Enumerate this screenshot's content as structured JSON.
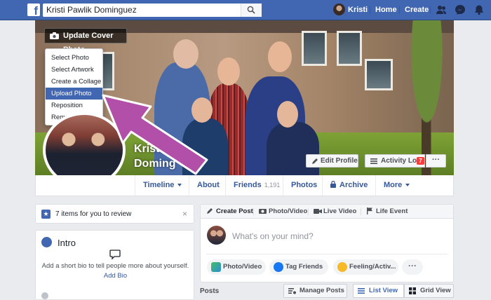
{
  "topbar": {
    "logo": "f",
    "search_value": "Kristi Pawlik Dominguez",
    "user_name": "Kristi",
    "links": [
      "Home",
      "Create"
    ]
  },
  "cover": {
    "update_label": "Update Cover Photo",
    "menu": [
      "Select Photo",
      "Select Artwork",
      "Create a Collage",
      "Upload Photo",
      "Reposition",
      "Remove"
    ],
    "active_menu_item": "Upload Photo",
    "name_line1": "Kristi",
    "name_line2": "Doming",
    "edit_profile": "Edit Profile",
    "activity_log": "Activity Log",
    "activity_badge": "7",
    "more": "···"
  },
  "tabs": {
    "timeline": "Timeline",
    "about": "About",
    "friends": "Friends",
    "friends_count": "1,191",
    "photos": "Photos",
    "archive": "Archive",
    "more": "More"
  },
  "review": {
    "text": "7 items for you to review",
    "close": "×"
  },
  "intro": {
    "title": "Intro",
    "desc": "Add a short bio to tell people more about yourself.",
    "link": "Add Bio"
  },
  "composer": {
    "tabs": [
      "Create Post",
      "Photo/Video",
      "Live Video",
      "Life Event"
    ],
    "placeholder": "What's on your mind?",
    "pills": [
      "Photo/Video",
      "Tag Friends",
      "Feeling/Activ..."
    ],
    "more": "···"
  },
  "posts": {
    "label": "Posts",
    "manage": "Manage Posts",
    "list_view": "List View",
    "grid_view": "Grid View"
  },
  "colors": {
    "brand": "#4267b2",
    "link": "#365899",
    "badge": "#fa3e3e",
    "arrow": "#b24fa8"
  }
}
